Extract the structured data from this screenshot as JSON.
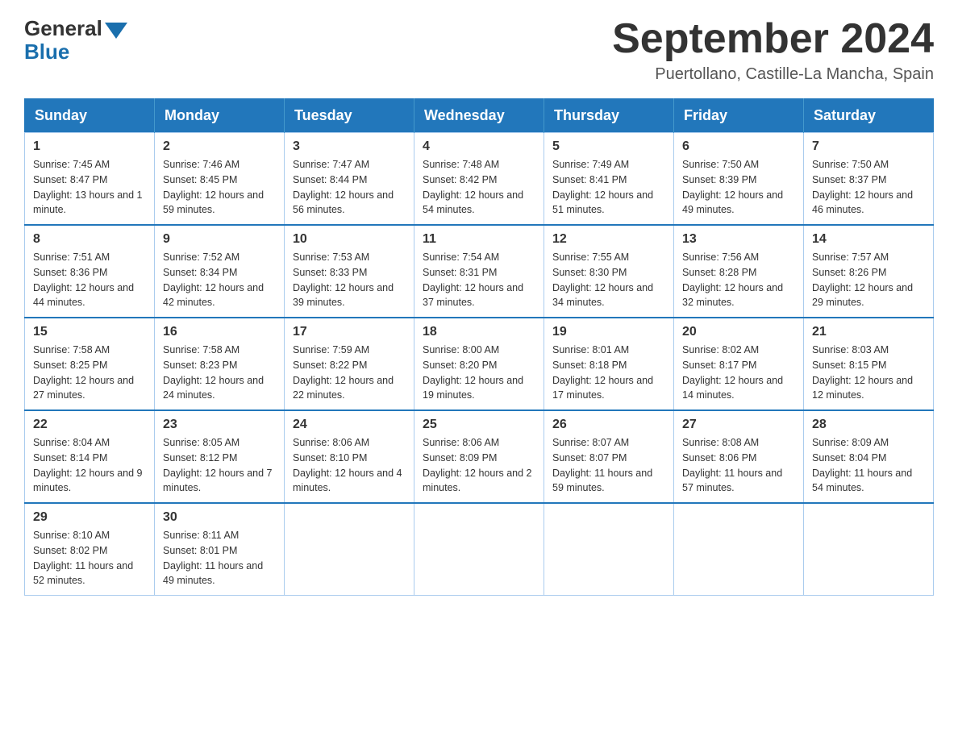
{
  "header": {
    "logo_general": "General",
    "logo_blue": "Blue",
    "month_title": "September 2024",
    "location": "Puertollano, Castille-La Mancha, Spain"
  },
  "days_of_week": [
    "Sunday",
    "Monday",
    "Tuesday",
    "Wednesday",
    "Thursday",
    "Friday",
    "Saturday"
  ],
  "weeks": [
    [
      {
        "day": "1",
        "sunrise": "7:45 AM",
        "sunset": "8:47 PM",
        "daylight": "13 hours and 1 minute."
      },
      {
        "day": "2",
        "sunrise": "7:46 AM",
        "sunset": "8:45 PM",
        "daylight": "12 hours and 59 minutes."
      },
      {
        "day": "3",
        "sunrise": "7:47 AM",
        "sunset": "8:44 PM",
        "daylight": "12 hours and 56 minutes."
      },
      {
        "day": "4",
        "sunrise": "7:48 AM",
        "sunset": "8:42 PM",
        "daylight": "12 hours and 54 minutes."
      },
      {
        "day": "5",
        "sunrise": "7:49 AM",
        "sunset": "8:41 PM",
        "daylight": "12 hours and 51 minutes."
      },
      {
        "day": "6",
        "sunrise": "7:50 AM",
        "sunset": "8:39 PM",
        "daylight": "12 hours and 49 minutes."
      },
      {
        "day": "7",
        "sunrise": "7:50 AM",
        "sunset": "8:37 PM",
        "daylight": "12 hours and 46 minutes."
      }
    ],
    [
      {
        "day": "8",
        "sunrise": "7:51 AM",
        "sunset": "8:36 PM",
        "daylight": "12 hours and 44 minutes."
      },
      {
        "day": "9",
        "sunrise": "7:52 AM",
        "sunset": "8:34 PM",
        "daylight": "12 hours and 42 minutes."
      },
      {
        "day": "10",
        "sunrise": "7:53 AM",
        "sunset": "8:33 PM",
        "daylight": "12 hours and 39 minutes."
      },
      {
        "day": "11",
        "sunrise": "7:54 AM",
        "sunset": "8:31 PM",
        "daylight": "12 hours and 37 minutes."
      },
      {
        "day": "12",
        "sunrise": "7:55 AM",
        "sunset": "8:30 PM",
        "daylight": "12 hours and 34 minutes."
      },
      {
        "day": "13",
        "sunrise": "7:56 AM",
        "sunset": "8:28 PM",
        "daylight": "12 hours and 32 minutes."
      },
      {
        "day": "14",
        "sunrise": "7:57 AM",
        "sunset": "8:26 PM",
        "daylight": "12 hours and 29 minutes."
      }
    ],
    [
      {
        "day": "15",
        "sunrise": "7:58 AM",
        "sunset": "8:25 PM",
        "daylight": "12 hours and 27 minutes."
      },
      {
        "day": "16",
        "sunrise": "7:58 AM",
        "sunset": "8:23 PM",
        "daylight": "12 hours and 24 minutes."
      },
      {
        "day": "17",
        "sunrise": "7:59 AM",
        "sunset": "8:22 PM",
        "daylight": "12 hours and 22 minutes."
      },
      {
        "day": "18",
        "sunrise": "8:00 AM",
        "sunset": "8:20 PM",
        "daylight": "12 hours and 19 minutes."
      },
      {
        "day": "19",
        "sunrise": "8:01 AM",
        "sunset": "8:18 PM",
        "daylight": "12 hours and 17 minutes."
      },
      {
        "day": "20",
        "sunrise": "8:02 AM",
        "sunset": "8:17 PM",
        "daylight": "12 hours and 14 minutes."
      },
      {
        "day": "21",
        "sunrise": "8:03 AM",
        "sunset": "8:15 PM",
        "daylight": "12 hours and 12 minutes."
      }
    ],
    [
      {
        "day": "22",
        "sunrise": "8:04 AM",
        "sunset": "8:14 PM",
        "daylight": "12 hours and 9 minutes."
      },
      {
        "day": "23",
        "sunrise": "8:05 AM",
        "sunset": "8:12 PM",
        "daylight": "12 hours and 7 minutes."
      },
      {
        "day": "24",
        "sunrise": "8:06 AM",
        "sunset": "8:10 PM",
        "daylight": "12 hours and 4 minutes."
      },
      {
        "day": "25",
        "sunrise": "8:06 AM",
        "sunset": "8:09 PM",
        "daylight": "12 hours and 2 minutes."
      },
      {
        "day": "26",
        "sunrise": "8:07 AM",
        "sunset": "8:07 PM",
        "daylight": "11 hours and 59 minutes."
      },
      {
        "day": "27",
        "sunrise": "8:08 AM",
        "sunset": "8:06 PM",
        "daylight": "11 hours and 57 minutes."
      },
      {
        "day": "28",
        "sunrise": "8:09 AM",
        "sunset": "8:04 PM",
        "daylight": "11 hours and 54 minutes."
      }
    ],
    [
      {
        "day": "29",
        "sunrise": "8:10 AM",
        "sunset": "8:02 PM",
        "daylight": "11 hours and 52 minutes."
      },
      {
        "day": "30",
        "sunrise": "8:11 AM",
        "sunset": "8:01 PM",
        "daylight": "11 hours and 49 minutes."
      },
      null,
      null,
      null,
      null,
      null
    ]
  ],
  "labels": {
    "sunrise": "Sunrise:",
    "sunset": "Sunset:",
    "daylight": "Daylight:"
  }
}
